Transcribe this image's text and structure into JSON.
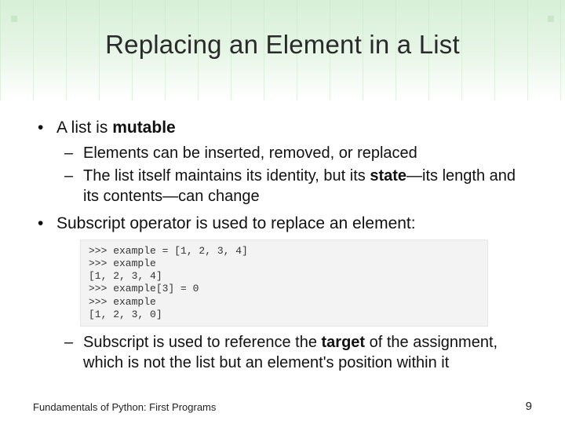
{
  "title": "Replacing an Element in a List",
  "bullets": {
    "b1": {
      "pre": "A list is ",
      "bold": "mutable"
    },
    "b1_sub1": "Elements can be inserted, removed, or replaced",
    "b1_sub2": {
      "pre": "The list itself maintains its identity, but its ",
      "bold": "state",
      "post": "—its length and its contents—can change"
    },
    "b2": "Subscript operator is used to replace an element:",
    "b2_sub1": {
      "pre": "Subscript is used to reference the ",
      "bold": "target",
      "post": " of the assignment, which is not the list but an element's position within it"
    }
  },
  "code": {
    "l1": ">>> example = [1, 2, 3, 4]",
    "l2": ">>> example",
    "l3": "[1, 2, 3, 4]",
    "l4": ">>> example[3] = 0",
    "l5": ">>> example",
    "l6": "[1, 2, 3, 0]"
  },
  "footer": {
    "left": "Fundamentals of Python: First Programs",
    "page": "9"
  }
}
